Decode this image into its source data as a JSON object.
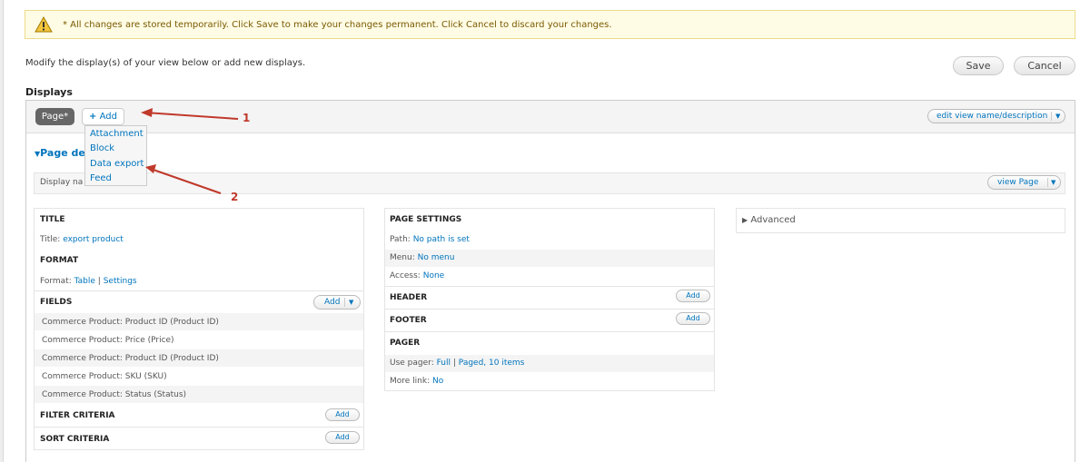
{
  "warning": {
    "text": "* All changes are stored temporarily. Click Save to make your changes permanent. Click Cancel to discard your changes."
  },
  "intro": "Modify the display(s) of your view below or add new displays.",
  "actions": {
    "save": "Save",
    "cancel": "Cancel"
  },
  "displays": {
    "heading": "Displays",
    "tab_page": "Page*",
    "tab_add": "Add",
    "add_menu": [
      "Attachment",
      "Block",
      "Data export",
      "Feed"
    ],
    "edit_view": "edit view name/description",
    "section_title": "Page de",
    "display_name_label": "Display na",
    "view_page": "view Page"
  },
  "left": {
    "title_h": "TITLE",
    "title_label": "Title:",
    "title_value": "export product",
    "format_h": "FORMAT",
    "format_label": "Format:",
    "format_value": "Table",
    "format_sep": "|",
    "format_settings": "Settings",
    "fields_h": "FIELDS",
    "fields_add": "Add",
    "fields": [
      "Commerce Product: Product ID (Product ID)",
      "Commerce Product: Price (Price)",
      "Commerce Product: Product ID (Product ID)",
      "Commerce Product: SKU (SKU)",
      "Commerce Product: Status (Status)"
    ],
    "filter_h": "FILTER CRITERIA",
    "filter_add": "Add",
    "sort_h": "SORT CRITERIA",
    "sort_add": "Add"
  },
  "middle": {
    "page_settings_h": "PAGE SETTINGS",
    "path_label": "Path:",
    "path_value": "No path is set",
    "menu_label": "Menu:",
    "menu_value": "No menu",
    "access_label": "Access:",
    "access_value": "None",
    "header_h": "HEADER",
    "header_add": "Add",
    "footer_h": "FOOTER",
    "footer_add": "Add",
    "pager_h": "PAGER",
    "pager_label": "Use pager:",
    "pager_full": "Full",
    "pager_sep": "|",
    "pager_paged": "Paged, 10 items",
    "more_label": "More link:",
    "more_value": "No"
  },
  "right": {
    "advanced": "Advanced"
  },
  "annotations": {
    "one": "1",
    "two": "2"
  },
  "colors": {
    "link": "#0074bd",
    "annotation": "#c0392b",
    "warning_bg": "#fffce5"
  }
}
